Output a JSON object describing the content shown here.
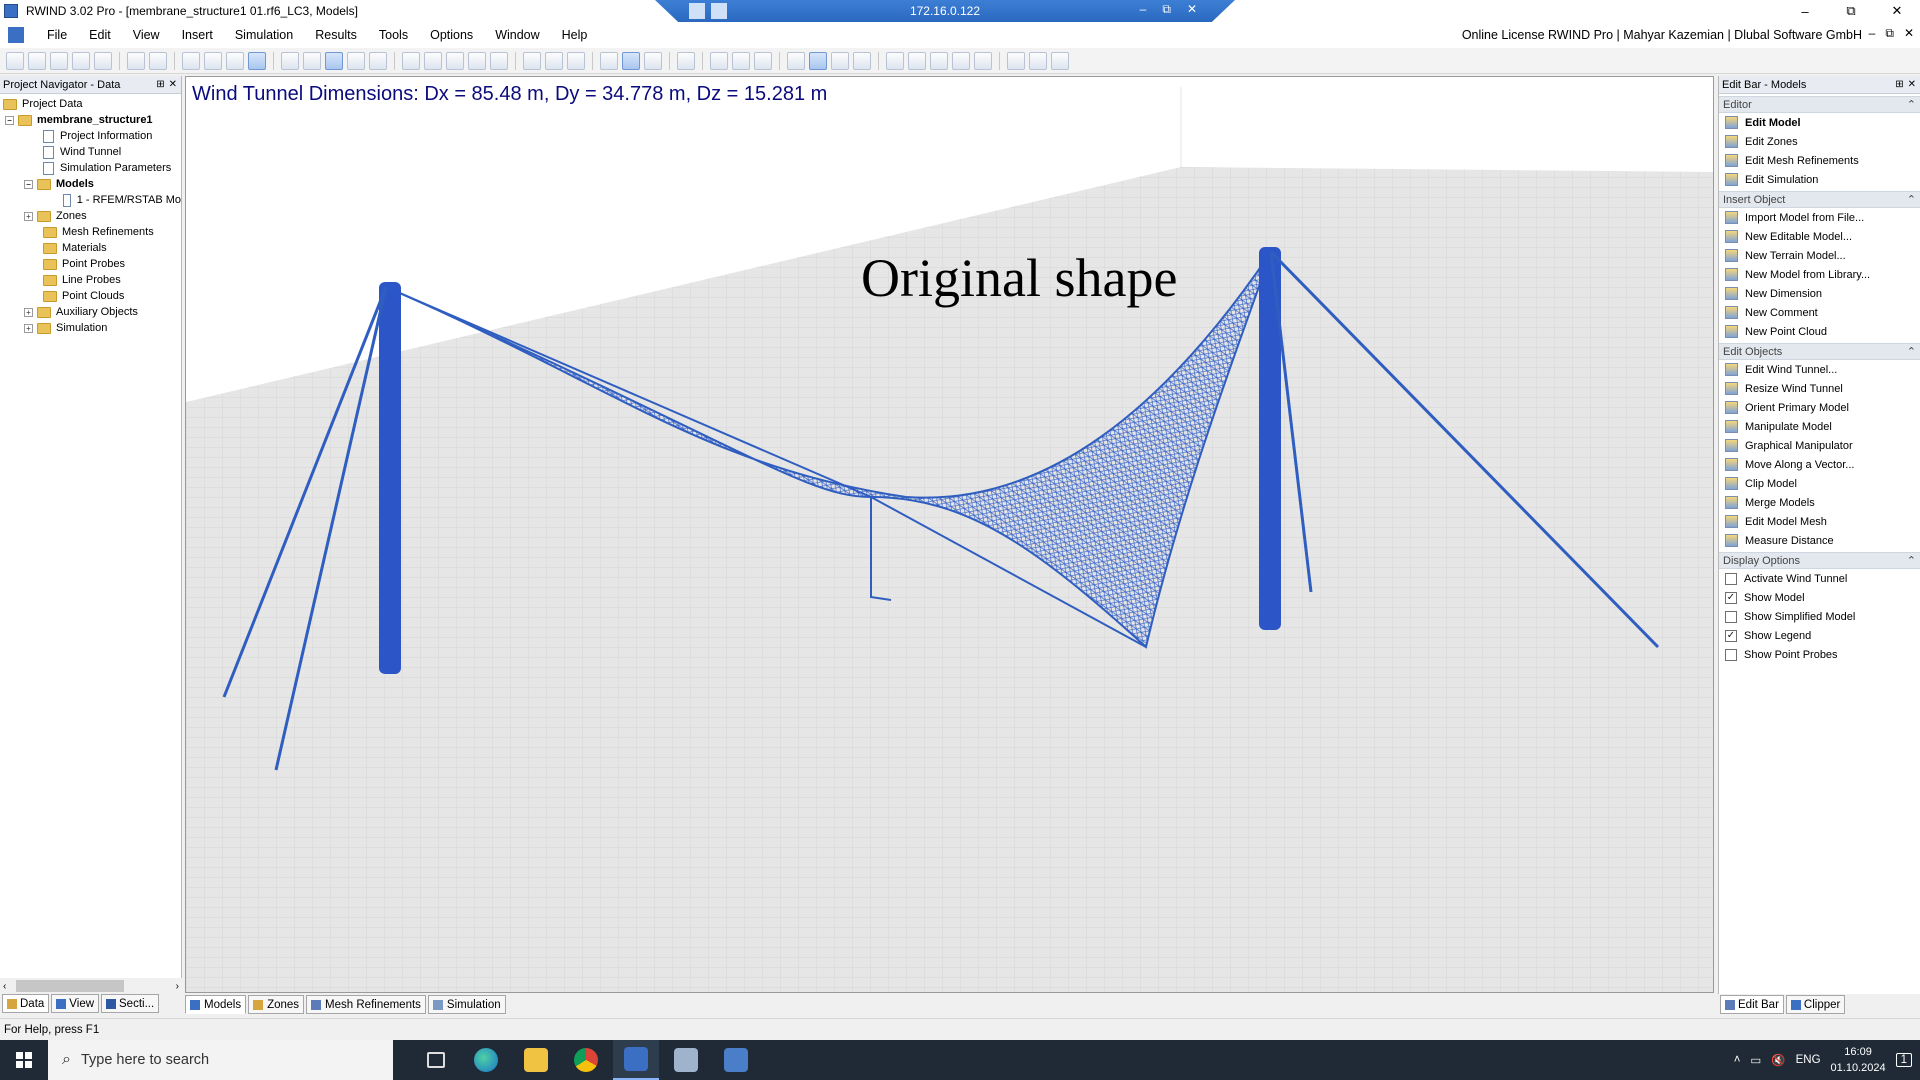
{
  "window": {
    "title": "RWIND 3.02 Pro - [membrane_structure1 01.rf6_LC3, Models]",
    "remote_ip": "172.16.0.122",
    "controls": [
      "–",
      "⧉",
      "✕"
    ]
  },
  "menu": {
    "items": [
      "File",
      "Edit",
      "View",
      "Insert",
      "Simulation",
      "Results",
      "Tools",
      "Options",
      "Window",
      "Help"
    ],
    "license": "Online License RWIND Pro | Mahyar Kazemian | Dlubal Software GmbH"
  },
  "navigator": {
    "title": "Project Navigator - Data",
    "root": "Project Data",
    "project": "membrane_structure1",
    "items": {
      "project_info": "Project Information",
      "wind_tunnel": "Wind Tunnel",
      "sim_params": "Simulation Parameters",
      "models": "Models",
      "model_1": "1 - RFEM/RSTAB Mo",
      "zones": "Zones",
      "mesh_ref": "Mesh Refinements",
      "materials": "Materials",
      "point_probes": "Point Probes",
      "line_probes": "Line Probes",
      "point_clouds": "Point Clouds",
      "aux_objects": "Auxiliary Objects",
      "simulation": "Simulation"
    },
    "tabs": [
      "Data",
      "View",
      "Secti..."
    ]
  },
  "viewport": {
    "dimensions_label": "Wind Tunnel Dimensions: Dx = 85.48 m, Dy = 34.778 m, Dz = 15.281 m",
    "shape_label": "Original shape",
    "tabs": [
      "Models",
      "Zones",
      "Mesh Refinements",
      "Simulation"
    ]
  },
  "editbar": {
    "title": "Edit Bar - Models",
    "sections": {
      "editor": "Editor",
      "insert": "Insert Object",
      "edit_objects": "Edit Objects",
      "display": "Display Options"
    },
    "editor_items": [
      "Edit Model",
      "Edit Zones",
      "Edit Mesh Refinements",
      "Edit Simulation"
    ],
    "insert_items": [
      "Import Model from File...",
      "New Editable Model...",
      "New Terrain Model...",
      "New Model from Library...",
      "New Dimension",
      "New Comment",
      "New Point Cloud"
    ],
    "edit_items": [
      "Edit Wind Tunnel...",
      "Resize Wind Tunnel",
      "Orient Primary Model",
      "Manipulate Model",
      "Graphical Manipulator",
      "Move Along a Vector...",
      "Clip Model",
      "Merge Models",
      "Edit Model Mesh",
      "Measure Distance"
    ],
    "display_items": [
      {
        "label": "Activate Wind Tunnel",
        "checked": ""
      },
      {
        "label": "Show Model",
        "checked": "✓"
      },
      {
        "label": "Show Simplified Model",
        "checked": ""
      },
      {
        "label": "Show Legend",
        "checked": "✓"
      },
      {
        "label": "Show Point Probes",
        "checked": ""
      }
    ],
    "tabs": [
      "Edit Bar",
      "Clipper"
    ]
  },
  "status": "For Help, press F1",
  "taskbar": {
    "search_placeholder": "Type here to search",
    "lang": "ENG",
    "time": "16:09",
    "date": "01.10.2024",
    "notif": "1"
  }
}
